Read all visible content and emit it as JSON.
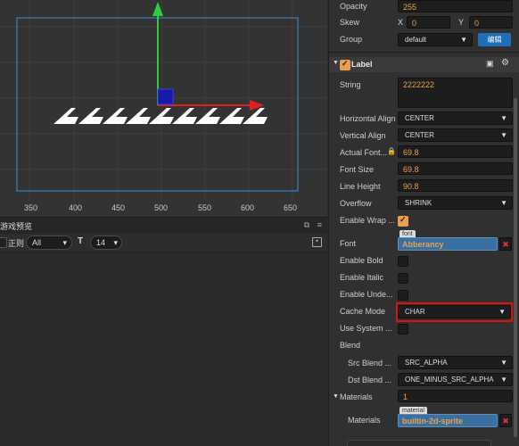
{
  "scene": {
    "ruler_labels": [
      "350",
      "400",
      "450",
      "500",
      "550",
      "600",
      "650"
    ],
    "label_string_display": "£££££££££"
  },
  "preview_bar": {
    "tab": "游戏预览"
  },
  "console_bar": {
    "regex_label": "正则",
    "level_select": "All",
    "font_size_select": "14"
  },
  "inspector": {
    "opacity": {
      "label": "Opacity",
      "value": "255"
    },
    "skew": {
      "label": "Skew",
      "x_label": "X",
      "x_value": "0",
      "y_label": "Y",
      "y_value": "0"
    },
    "group": {
      "label": "Group",
      "value": "default",
      "edit_button": "编辑"
    },
    "label_component": {
      "title": "Label"
    },
    "string": {
      "label": "String",
      "value": "2222222"
    },
    "h_align": {
      "label": "Horizontal Align",
      "value": "CENTER"
    },
    "v_align": {
      "label": "Vertical Align",
      "value": "CENTER"
    },
    "actual_font": {
      "label": "Actual Font...",
      "value": "69.8"
    },
    "font_size": {
      "label": "Font Size",
      "value": "69.8"
    },
    "line_height": {
      "label": "Line Height",
      "value": "90.8"
    },
    "overflow": {
      "label": "Overflow",
      "value": "SHRINK"
    },
    "enable_wrap": {
      "label": "Enable Wrap ..."
    },
    "font": {
      "label": "Font",
      "tag": "font",
      "value": "Abberancy"
    },
    "enable_bold": {
      "label": "Enable Bold"
    },
    "enable_italic": {
      "label": "Enable Italic"
    },
    "enable_underline": {
      "label": "Enable Unde..."
    },
    "cache_mode": {
      "label": "Cache Mode",
      "value": "CHAR"
    },
    "use_system": {
      "label": "Use System ..."
    },
    "blend": {
      "label": "Blend"
    },
    "src_blend": {
      "label": "Src Blend ...",
      "value": "SRC_ALPHA"
    },
    "dst_blend": {
      "label": "Dst Blend ...",
      "value": "ONE_MINUS_SRC_ALPHA"
    },
    "materials_group": {
      "label": "Materials",
      "value": "1"
    },
    "materials_item": {
      "label": "Materials",
      "tag": "material",
      "value": "builtin-2d-sprite"
    }
  }
}
